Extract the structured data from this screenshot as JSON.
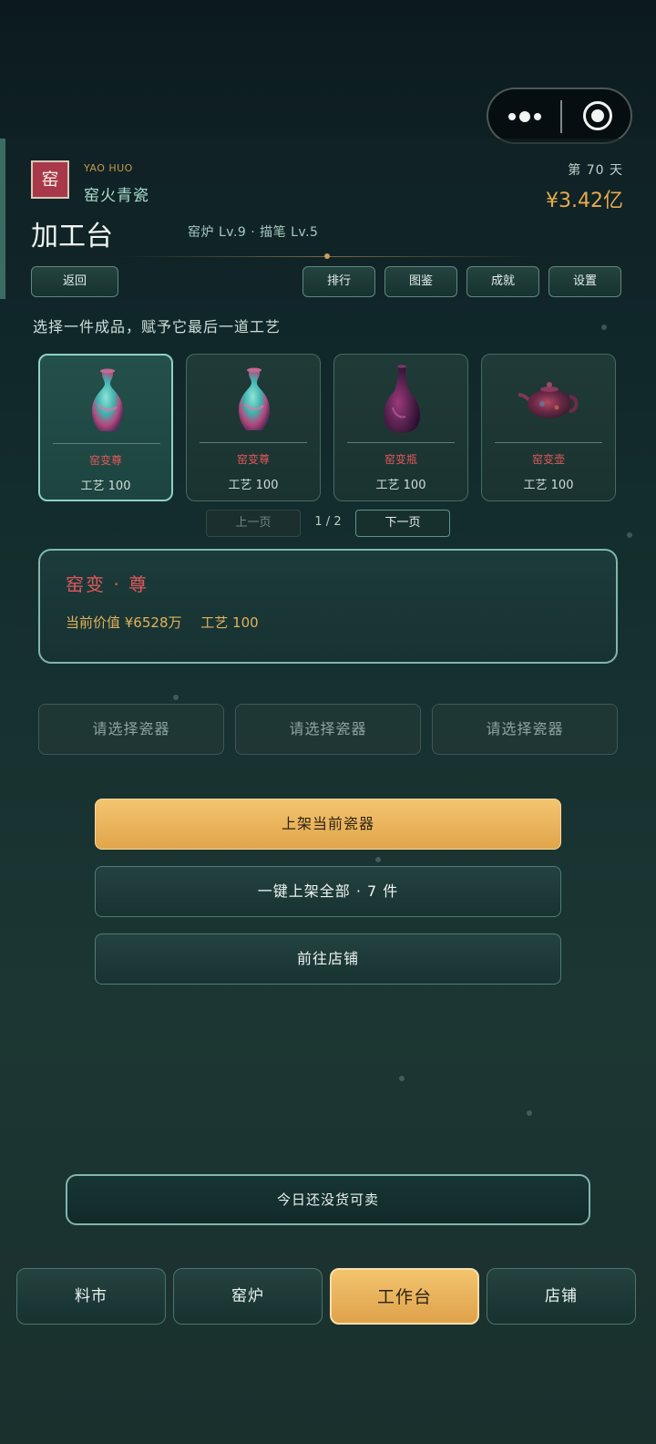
{
  "capsule": {
    "more_icon": "more-dots-icon",
    "close_icon": "target-circle-icon"
  },
  "header": {
    "seal_char": "窑",
    "brand_en": "YAO HUO",
    "brand_name": "窑火青瓷",
    "day": "第 70 天",
    "money": "¥3.42亿",
    "title": "加工台",
    "levels": "窑炉 Lv.9 · 描笔 Lv.5",
    "back_label": "返回",
    "nav_buttons": [
      "排行",
      "图鉴",
      "成就",
      "设置"
    ]
  },
  "instruction": "选择一件成品，赋予它最后一道工艺",
  "items": [
    {
      "name": "窑变尊",
      "skill": "工艺 100",
      "selected": true,
      "art": "vase-icon"
    },
    {
      "name": "窑变尊",
      "skill": "工艺 100",
      "selected": false,
      "art": "vase-icon"
    },
    {
      "name": "窑变瓶",
      "skill": "工艺 100",
      "selected": false,
      "art": "bottle-icon"
    },
    {
      "name": "窑变壶",
      "skill": "工艺 100",
      "selected": false,
      "art": "teapot-icon"
    }
  ],
  "pager": {
    "prev": "上一页",
    "page": "1 / 2",
    "next": "下一页"
  },
  "detail": {
    "title": "窑变 · 尊",
    "value": "当前价值 ¥6528万",
    "skill": "工艺 100"
  },
  "slots": [
    "请选择瓷器",
    "请选择瓷器",
    "请选择瓷器"
  ],
  "actions": {
    "list_current": "上架当前瓷器",
    "list_all": "一键上架全部 · 7 件",
    "go_shop": "前往店铺"
  },
  "status": "今日还没货可卖",
  "tabs": [
    {
      "label": "料市",
      "active": false
    },
    {
      "label": "窑炉",
      "active": false
    },
    {
      "label": "工作台",
      "active": true
    },
    {
      "label": "店铺",
      "active": false
    }
  ],
  "colors": {
    "accent_gold": "#e9a94e",
    "item_name_red": "#e0585a",
    "teal_border": "#7fb7ac"
  }
}
